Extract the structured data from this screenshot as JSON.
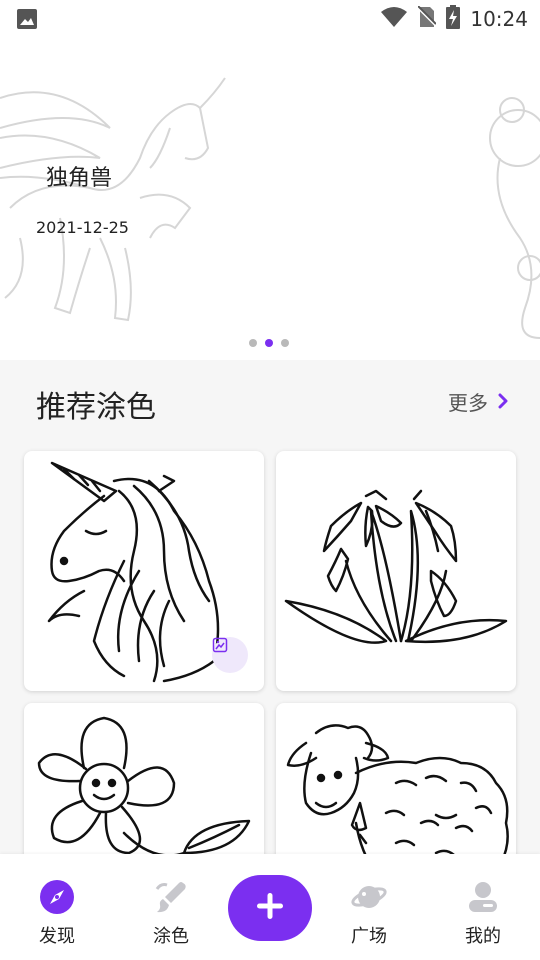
{
  "status_bar": {
    "time": "10:24"
  },
  "banner": {
    "title": "独角兽",
    "date": "2021-12-25",
    "slide_count": 3,
    "active_slide": 2
  },
  "section": {
    "title": "推荐涂色",
    "more_label": "更多"
  },
  "cards": [
    {
      "subject": "unicorn"
    },
    {
      "subject": "snowdrop flowers"
    },
    {
      "subject": "smiling flower"
    },
    {
      "subject": "sheep"
    }
  ],
  "nav": [
    {
      "label": "发现",
      "icon": "compass-icon",
      "active": true
    },
    {
      "label": "涂色",
      "icon": "paint-brush-icon",
      "active": false
    },
    {
      "label": "",
      "icon": "plus-icon",
      "active": false
    },
    {
      "label": "广场",
      "icon": "planet-icon",
      "active": false
    },
    {
      "label": "我的",
      "icon": "user-icon",
      "active": false
    }
  ],
  "colors": {
    "accent": "#7b2ff0",
    "inactive_icon": "#c7c7cc",
    "background": "#f6f6f6"
  }
}
